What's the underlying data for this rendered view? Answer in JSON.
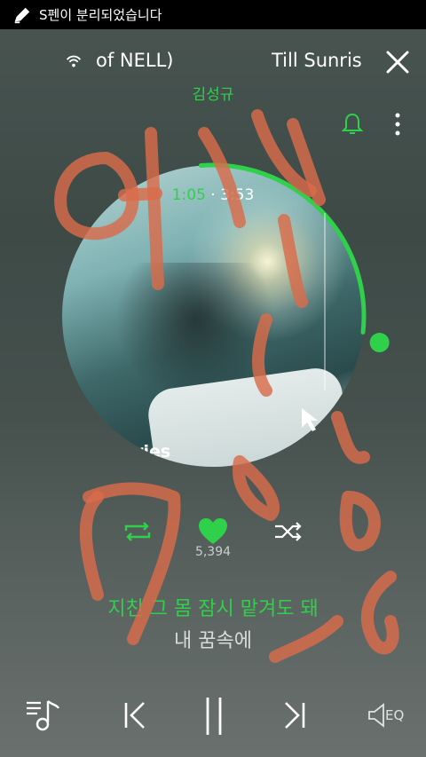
{
  "status_bar": {
    "message": "S펜이 분리되었습니다",
    "icon": "pen-icon"
  },
  "track": {
    "title_left": "of NELL)",
    "title_right": "Till Sunris",
    "artist": "김성규"
  },
  "player": {
    "current_time": "1:05",
    "separator": "·",
    "total_time": "3:53",
    "progress_fraction": 0.28,
    "album_text": "tories"
  },
  "actions": {
    "like_count": "5,394",
    "repeat_icon": "repeat-icon",
    "heart_icon": "heart-icon",
    "shuffle_icon": "shuffle-icon"
  },
  "lyrics": {
    "current": "지친 그 몸 잠시 맡겨도 돼",
    "next": "내 꿈속에"
  },
  "bottom": {
    "eq_label": "EQ"
  },
  "colors": {
    "accent": "#2fd04a",
    "scribble": "#d96b4b"
  }
}
